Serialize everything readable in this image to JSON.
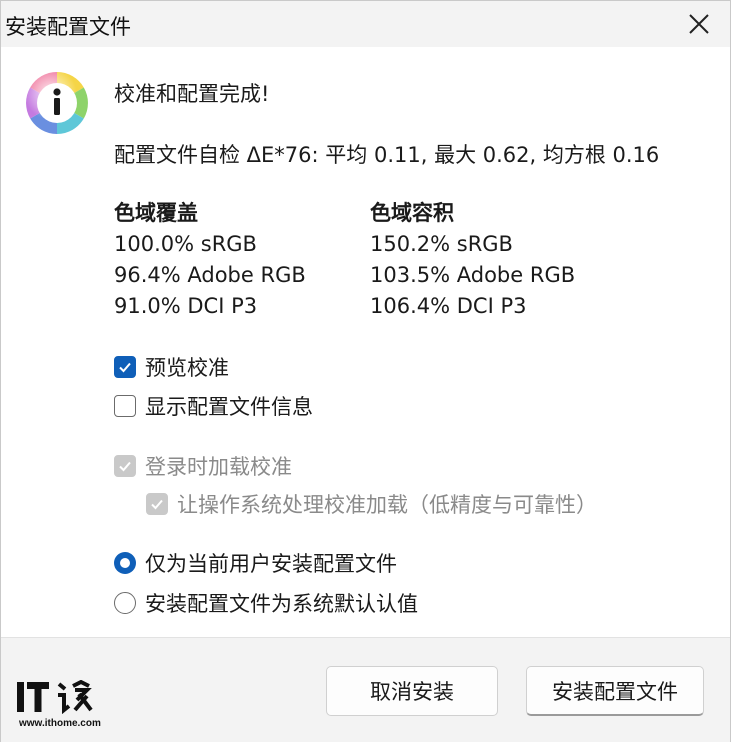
{
  "window": {
    "title": "安装配置文件"
  },
  "dialog": {
    "heading": "校准和配置完成!",
    "selfcheck": "配置文件自检 ΔE*76: 平均 0.11, 最大 0.62, 均方根 0.16",
    "gamut_coverage": {
      "header": "色域覆盖",
      "rows": [
        "100.0% sRGB",
        "96.4% Adobe RGB",
        "91.0% DCI P3"
      ]
    },
    "gamut_volume": {
      "header": "色域容积",
      "rows": [
        "150.2% sRGB",
        "103.5% Adobe RGB",
        "106.4% DCI P3"
      ]
    }
  },
  "options": {
    "preview_calibration": {
      "label": "预览校准",
      "checked": true
    },
    "show_profile_info": {
      "label": "显示配置文件信息",
      "checked": false
    },
    "load_on_login": {
      "label": "登录时加载校准",
      "checked": true,
      "disabled": true
    },
    "os_handle_loading": {
      "label": "让操作系统处理校准加载（低精度与可靠性）",
      "checked": true,
      "disabled": true
    },
    "install_current_user": {
      "label": "仅为当前用户安装配置文件",
      "selected": true
    },
    "install_system_default": {
      "label": "安装配置文件为系统默认认值",
      "selected": false
    }
  },
  "buttons": {
    "cancel": "取消安装",
    "install": "安装配置文件"
  },
  "watermark": {
    "logo_text": "IT之家",
    "site": "www.ithome.com"
  },
  "colors": {
    "accent": "#0f5fb8",
    "disabled": "#c9c9c9",
    "chrome": "#f3f3f3"
  }
}
